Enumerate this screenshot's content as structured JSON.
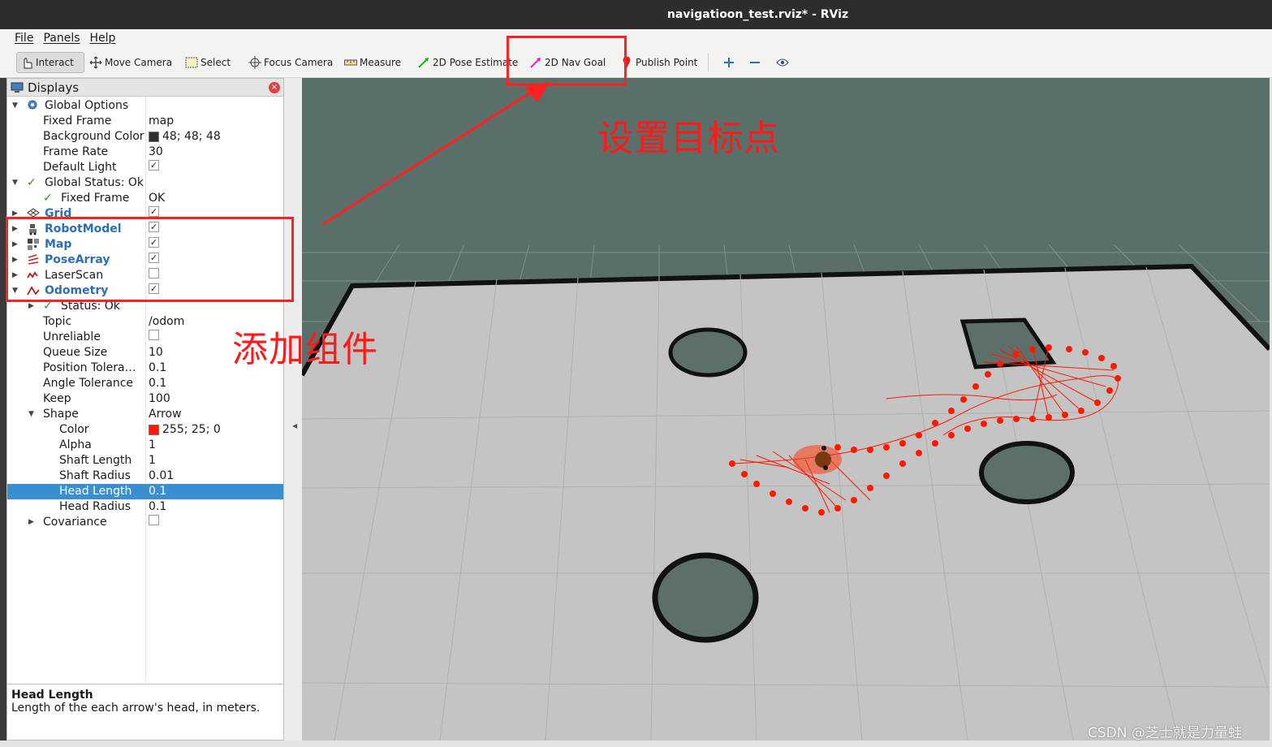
{
  "window": {
    "title": "navigatioon_test.rviz* - RViz"
  },
  "menu": [
    "File",
    "Panels",
    "Help"
  ],
  "toolbar": {
    "interact": "Interact",
    "move_camera": "Move Camera",
    "select": "Select",
    "focus_camera": "Focus Camera",
    "measure": "Measure",
    "pose_estimate": "2D Pose Estimate",
    "nav_goal": "2D Nav Goal",
    "publish_point": "Publish Point"
  },
  "displays": {
    "header": "Displays",
    "global_options": {
      "label": "Global Options",
      "fixed_frame": {
        "name": "Fixed Frame",
        "value": "map"
      },
      "background_color": {
        "name": "Background Color",
        "value": "48; 48; 48",
        "color": "#303030"
      },
      "frame_rate": {
        "name": "Frame Rate",
        "value": "30"
      },
      "default_light": {
        "name": "Default Light",
        "checked": true
      }
    },
    "global_status": {
      "label": "Global Status: Ok",
      "fixed_frame": {
        "name": "Fixed Frame",
        "value": "OK"
      }
    },
    "items": [
      {
        "label": "Grid",
        "checked": true
      },
      {
        "label": "RobotModel",
        "checked": true
      },
      {
        "label": "Map",
        "checked": true
      },
      {
        "label": "PoseArray",
        "checked": true
      },
      {
        "label": "LaserScan",
        "checked": false
      },
      {
        "label": "Odometry",
        "checked": true
      }
    ],
    "odometry_props": {
      "status": "Status: Ok",
      "topic": {
        "name": "Topic",
        "value": "/odom"
      },
      "unreliable": {
        "name": "Unreliable",
        "checked": false
      },
      "queue_size": {
        "name": "Queue Size",
        "value": "10"
      },
      "position_tolerance": {
        "name": "Position Tolera…",
        "value": "0.1"
      },
      "angle_tolerance": {
        "name": "Angle Tolerance",
        "value": "0.1"
      },
      "keep": {
        "name": "Keep",
        "value": "100"
      },
      "shape": {
        "name": "Shape",
        "value": "Arrow"
      },
      "color": {
        "name": "Color",
        "value": "255; 25; 0",
        "color": "#ff1900"
      },
      "alpha": {
        "name": "Alpha",
        "value": "1"
      },
      "shaft_length": {
        "name": "Shaft Length",
        "value": "1"
      },
      "shaft_radius": {
        "name": "Shaft Radius",
        "value": "0.01"
      },
      "head_length": {
        "name": "Head Length",
        "value": "0.1"
      },
      "head_radius": {
        "name": "Head Radius",
        "value": "0.1"
      },
      "covariance": {
        "name": "Covariance",
        "checked": false
      }
    }
  },
  "description": {
    "title": "Head Length",
    "text": "Length of the each arrow's head, in meters."
  },
  "annotations": {
    "set_goal": "设置目标点",
    "add_component": "添加组件",
    "color": "#ff1a1a"
  },
  "watermark": "CSDN @芝士就是力量蛙",
  "colors": {
    "selection": "#3a8fd0",
    "view_background": "#5a6f69",
    "floor": "#c4c4c4",
    "odometry_arrows": "#ff1900"
  }
}
